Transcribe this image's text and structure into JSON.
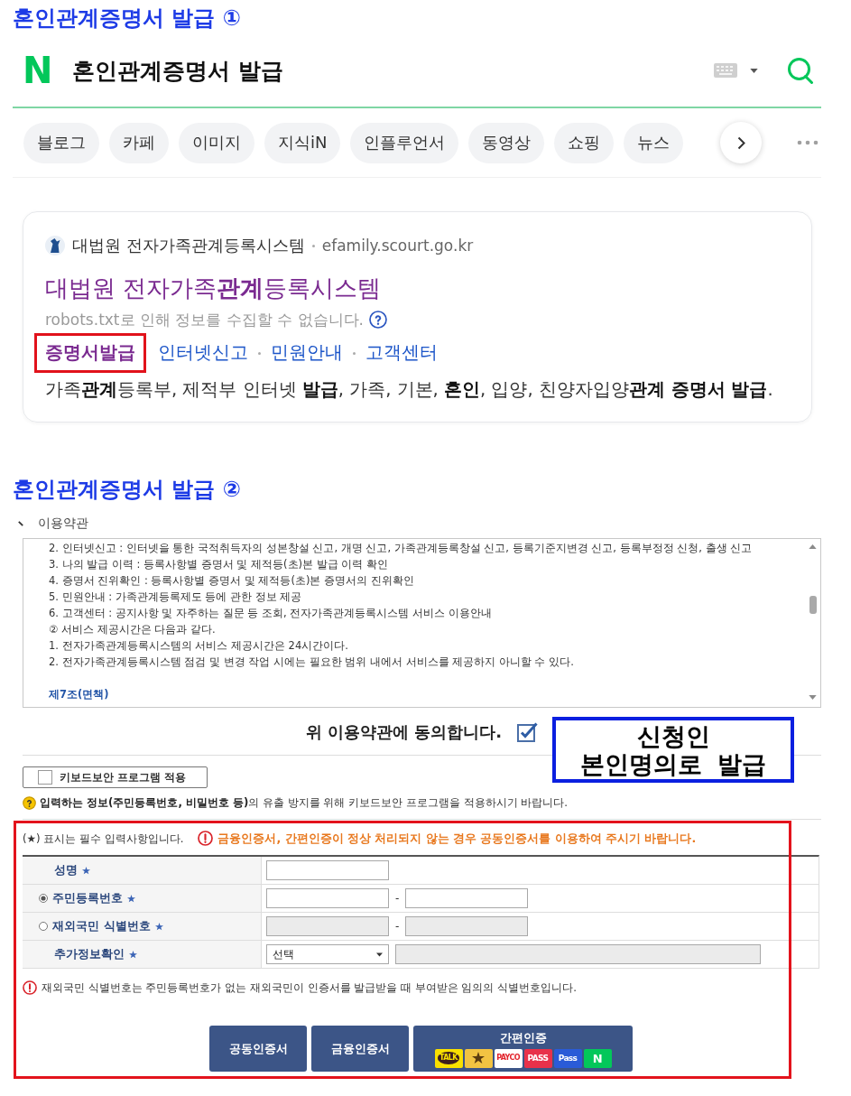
{
  "heading_1": "혼인관계증명서 발급 ①",
  "search_bar": {
    "logo": "N",
    "query": "혼인관계증명서 발급"
  },
  "category_tabs": [
    {
      "label": "블로그",
      "selected": false
    },
    {
      "label": "카페",
      "selected": false
    },
    {
      "label": "이미지",
      "selected": false
    },
    {
      "label": "지식iN",
      "selected": false
    },
    {
      "label": "인플루언서",
      "selected": false
    },
    {
      "label": "동영상",
      "selected": false
    },
    {
      "label": "쇼핑",
      "selected": false
    },
    {
      "label": "뉴스",
      "selected": false
    }
  ],
  "search_result": {
    "site_name": "대법원 전자가족관계등록시스템",
    "url": "efamily.scourt.go.kr",
    "title": "대법원 전자가족**관계**등록시스템",
    "notice": "robots.txt로 인해 정보를 수집할 수 없습니다.",
    "sitelinks": [
      {
        "label": "증명서발급",
        "highlighted": true
      },
      {
        "label": "인터넷신고",
        "highlighted": false
      },
      {
        "label": "민원안내",
        "highlighted": false
      },
      {
        "label": "고객센터",
        "highlighted": false
      }
    ],
    "description": "가족**관계**등록부, 제적부 인터넷 **발급**, 가족, 기본, **혼인**, 입양, 친양자입양**관계 증명서 발급**."
  },
  "heading_2": "혼인관계증명서 발급 ②",
  "terms": {
    "title": "이용약관",
    "lines": [
      {
        "kind": "item",
        "text": "2. 인터넷신고 : 인터넷을 통한 국적취득자의 성본창설 신고, 개명 신고, 가족관계등록창설 신고, 등록기준지변경 신고, 등록부정정 신청, 출생 신고"
      },
      {
        "kind": "item",
        "text": "3. 나의 발급 이력 : 등록사항별 증명서 및 제적등(초)본 발급 이력 확인"
      },
      {
        "kind": "item",
        "text": "4. 증명서 진위확인 : 등록사항별 증명서 및 제적등(초)본 증명서의 진위확인"
      },
      {
        "kind": "item",
        "text": "5. 민원안내 : 가족관계등록제도 등에 관한 정보 제공"
      },
      {
        "kind": "item",
        "text": "6. 고객센터 : 공지사항 및 자주하는 질문 등 조회, 전자가족관계등록시스템 서비스 이용안내"
      },
      {
        "kind": "item",
        "text": "② 서비스 제공시간은 다음과 같다."
      },
      {
        "kind": "item",
        "text": "1. 전자가족관계등록시스템의 서비스 제공시간은 24시간이다."
      },
      {
        "kind": "item",
        "text": "2. 전자가족관계등록시스템 점검 및 변경 작업 시에는 필요한 범위 내에서 서비스를 제공하지 아니할 수 있다."
      },
      {
        "kind": "heading",
        "text": "제7조(면책)"
      }
    ]
  },
  "agreement": {
    "label": "위 이용약관에 동의합니다.",
    "checked": true
  },
  "callout": {
    "lines": [
      "신청인",
      "본인명의로 발급"
    ]
  },
  "keyboard_security": {
    "label": "키보드보안 프로그램 적용",
    "checked": false,
    "notice": "**입력하는 정보(주민등록번호, 비밀번호 등)**의 유출 방지를 위해 키보드보안 프로그램을 적용하시기 바랍니다."
  },
  "form": {
    "required_note": "(★) 표시는 필수 입력사항입니다.",
    "warning": "금융인증서, 간편인증이 정상 처리되지 않는 경우 공동인증서를 이용하여 주시기 바랍니다.",
    "rows": [
      {
        "label": "성명",
        "required": true,
        "fields": [
          {
            "kind": "input",
            "disabled": false
          }
        ]
      },
      {
        "label": "주민등록번호",
        "required": true,
        "selected": true,
        "fields": [
          {
            "kind": "input",
            "disabled": false
          },
          {
            "kind": "dash",
            "text": "-"
          },
          {
            "kind": "input",
            "disabled": false
          }
        ]
      },
      {
        "label": "재외국민 식별번호",
        "required": true,
        "selected": false,
        "fields": [
          {
            "kind": "input",
            "disabled": true
          },
          {
            "kind": "dash",
            "text": "-"
          },
          {
            "kind": "input",
            "disabled": true
          }
        ]
      },
      {
        "label": "추가정보확인",
        "required": true,
        "fields": [
          {
            "kind": "select",
            "value": "선택"
          },
          {
            "kind": "long_input",
            "disabled": true
          }
        ]
      }
    ],
    "foreign_note": "재외국민 식별번호는 주민등록번호가 없는 재외국민이 인증서를 발급받을 때 부여받은 임의의 식별번호입니다.",
    "buttons": [
      {
        "kind": "plain",
        "label": "공동인증서"
      },
      {
        "kind": "plain",
        "label": "금융인증서"
      },
      {
        "kind": "providers",
        "label": "간편인증",
        "providers": [
          {
            "kind": "talk",
            "label": "TALK"
          },
          {
            "kind": "star"
          },
          {
            "kind": "payco",
            "label": "PAYCO"
          },
          {
            "kind": "pass",
            "label": "PASS"
          },
          {
            "kind": "pass_blue",
            "label": "Pass"
          },
          {
            "kind": "n",
            "label": "N"
          }
        ]
      }
    ]
  }
}
